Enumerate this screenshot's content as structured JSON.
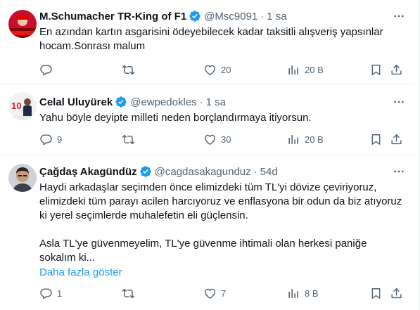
{
  "tweets": [
    {
      "name": "M.Schumacher TR-King of F1",
      "handle": "@Msc9091",
      "dot": "·",
      "time": "1 sa",
      "text": "En azından kartın asgarisini ödeyebilecek kadar taksitli alışveriş yapsınlar hocam.Sonrası malum",
      "replies": "",
      "retweets": "",
      "likes": "20",
      "views": "20 B"
    },
    {
      "name": "Celal Uluyürek",
      "handle": "@ewpedokles",
      "dot": "·",
      "time": "1 sa",
      "text": "Yahu böyle deyipte milleti neden borçlandırmaya itiyorsun.",
      "replies": "9",
      "retweets": "",
      "likes": "30",
      "views": "20 B"
    },
    {
      "name": "Çağdaş Akagündüz",
      "handle": "@cagdasakagunduz",
      "dot": "·",
      "time": "54d",
      "text": "Haydi arkadaşlar seçimden önce elimizdeki tüm TL'yi dövize çeviriyoruz, elimizdeki tüm parayı acilen harcıyoruz ve enflasyona bir odun da biz atıyoruz ki yerel seçimlerde muhalefetin eli güçlensin.\n\nAsla TL'ye güvenmeyelim, TL'ye güvenme ihtimali olan herkesi paniğe sokalım ki...",
      "show_more": "Daha fazla göster",
      "replies": "1",
      "retweets": "",
      "likes": "7",
      "views": "8 B"
    }
  ],
  "icons": {
    "verified": "verified-badge-icon",
    "more": "more-icon",
    "reply": "reply-icon",
    "retweet": "retweet-icon",
    "like": "like-icon",
    "views": "views-icon",
    "bookmark": "bookmark-icon",
    "share": "share-icon"
  },
  "colors": {
    "text": "#0f1419",
    "secondary": "#536471",
    "accent": "#1d9bf0",
    "divider": "#eff3f4"
  }
}
